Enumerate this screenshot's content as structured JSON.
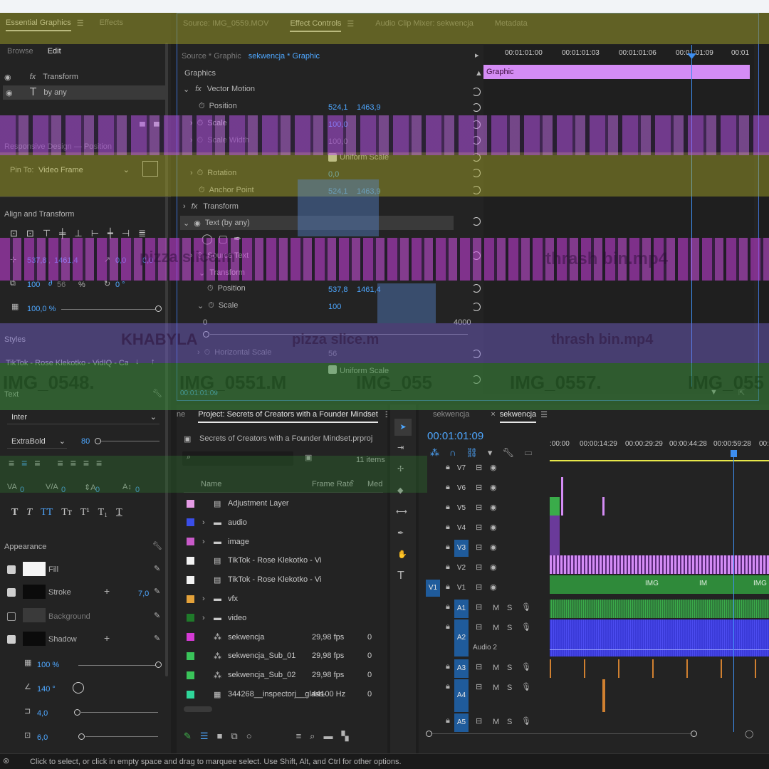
{
  "essential_graphics": {
    "tabs": [
      "Essential Graphics",
      "Effects"
    ],
    "subtabs": [
      "Browse",
      "Edit"
    ],
    "layers": [
      "Transform",
      "by any"
    ],
    "responsive_design": "Responsive Design — Position",
    "pin_to_label": "Pin To:",
    "pin_to_value": "Video Frame",
    "align_transform": "Align and Transform",
    "pos_x": "537,8",
    "pos_x_sep": ",",
    "pos_y": "1461,4",
    "rot": "0,0",
    "rot2": "0,0",
    "scale": "100",
    "scale2": "56",
    "scale_unit": "%",
    "anchor_rot": "0 °",
    "opacity": "100,0 %",
    "styles_label": "Styles",
    "style_value": "TikTok - Rose Klekotko - VidIQ - Capti...",
    "text_label": "Text",
    "font": "Inter",
    "font_style": "ExtraBold",
    "font_size": "80",
    "kerning": "0",
    "tracking": "0",
    "leading": "0",
    "baseline": "0",
    "appearance": "Appearance",
    "fill": "Fill",
    "stroke": "Stroke",
    "stroke_width": "7,0",
    "background": "Background",
    "shadow": "Shadow",
    "shadow_opacity": "100 %",
    "shadow_angle": "140 °",
    "shadow_distance": "4,0",
    "shadow_blur": "6,0"
  },
  "effect_controls": {
    "tabs": [
      "Source: IMG_0559.MOV",
      "Effect Controls",
      "Audio Clip Mixer: sekwencja",
      "Metadata"
    ],
    "source_label": "Source * Graphic",
    "sequence_label": "sekwencja * Graphic",
    "section": "Graphics",
    "vector_motion": "Vector Motion",
    "position": "Position",
    "position_x": "524,1",
    "position_y": "1463,9",
    "scale": "Scale",
    "scale_val": "100,0",
    "scale_width": "Scale Width",
    "scale_width_val": "100,0",
    "uniform_scale": "Uniform Scale",
    "rotation": "Rotation",
    "rotation_val": "0,0",
    "anchor_point": "Anchor Point",
    "anchor_x": "524,1",
    "anchor_y": "1463,9",
    "transform": "Transform",
    "text_layer": "Text (by any)",
    "source_text": "Source Text",
    "transform2": "Transform",
    "position2": "Position",
    "position2_x": "537,8",
    "position2_y": "1461,4",
    "scale2": "Scale",
    "scale2_val": "100",
    "range_min": "0",
    "range_max": "4000",
    "horizontal_scale": "Horizontal Scale",
    "horizontal_scale_val": "56",
    "uniform_scale2": "Uniform Scale",
    "timecode": "00:01:01:09",
    "ruler": [
      "00:01:01:00",
      "00:01:01:03",
      "00:01:01:06",
      "00:01:01:09",
      "00:01"
    ],
    "clip": "Graphic"
  },
  "project": {
    "tabs": [
      "ne",
      "Project: Secrets of Creators with a Founder Mindset"
    ],
    "file": "Secrets of Creators with a Founder Mindset.prproj",
    "count": "11 items",
    "columns": [
      "Name",
      "Frame Rate",
      "Med"
    ],
    "items": [
      {
        "name": "Adjustment Layer",
        "fps": "",
        "med": "",
        "color": "#e59be5",
        "kind": "file"
      },
      {
        "name": "audio",
        "fps": "",
        "med": "",
        "color": "#3a4ee8",
        "kind": "folder"
      },
      {
        "name": "image",
        "fps": "",
        "med": "",
        "color": "#c95ac9",
        "kind": "folder"
      },
      {
        "name": "TikTok - Rose Klekotko - Vi",
        "fps": "",
        "med": "",
        "color": "#f2f2f2",
        "kind": "file"
      },
      {
        "name": "TikTok - Rose Klekotko - Vi",
        "fps": "",
        "med": "",
        "color": "#f2f2f2",
        "kind": "file"
      },
      {
        "name": "vfx",
        "fps": "",
        "med": "",
        "color": "#e4a23a",
        "kind": "folder"
      },
      {
        "name": "video",
        "fps": "",
        "med": "",
        "color": "#1f7a2a",
        "kind": "folder"
      },
      {
        "name": "sekwencja",
        "fps": "29,98 fps",
        "med": "0",
        "color": "#d43ad4",
        "kind": "seq"
      },
      {
        "name": "sekwencja_Sub_01",
        "fps": "29,98 fps",
        "med": "0",
        "color": "#3ac45a",
        "kind": "seq"
      },
      {
        "name": "sekwencja_Sub_02",
        "fps": "29,98 fps",
        "med": "0",
        "color": "#3ac45a",
        "kind": "seq"
      },
      {
        "name": "344268__inspectorj__glass-",
        "fps": "44100 Hz",
        "med": "0",
        "color": "#2fd69a",
        "kind": "audio"
      }
    ]
  },
  "timeline": {
    "tabs": [
      "sekwencja",
      "sekwencja"
    ],
    "timecode": "00:01:01:09",
    "ruler": [
      ":00:00",
      "00:00:14:29",
      "00:00:29:29",
      "00:00:44:28",
      "00:00:59:28",
      "00:0"
    ],
    "video_tracks": [
      "V7",
      "V6",
      "V5",
      "V4",
      "V3",
      "V2",
      "V1"
    ],
    "audio_tracks": [
      "A1",
      "A2",
      "A3",
      "A4",
      "A5"
    ],
    "source_patch_v": "V1",
    "audio2_label": "Audio 2",
    "mute": "M",
    "solo": "S",
    "v1_clip_labels": [
      "IMG",
      "IM",
      "IMG"
    ]
  },
  "glitch_text": {
    "clip1": "pizza slice.m",
    "clip2": "thrash bin.mp4",
    "clip3": "KHABYLA",
    "clip4": "pizza slice.m",
    "clip5": "thrash bin.mp4",
    "clip6": "IMG_0548.",
    "clip7": "IMG_0551.M",
    "clip8": "IMG_055",
    "clip9": "IMG_0557.",
    "clip10": "IMG_055"
  },
  "status": {
    "hint": "Click to select, or click in empty space and drag to marquee select. Use Shift, Alt, and Ctrl for other options."
  }
}
